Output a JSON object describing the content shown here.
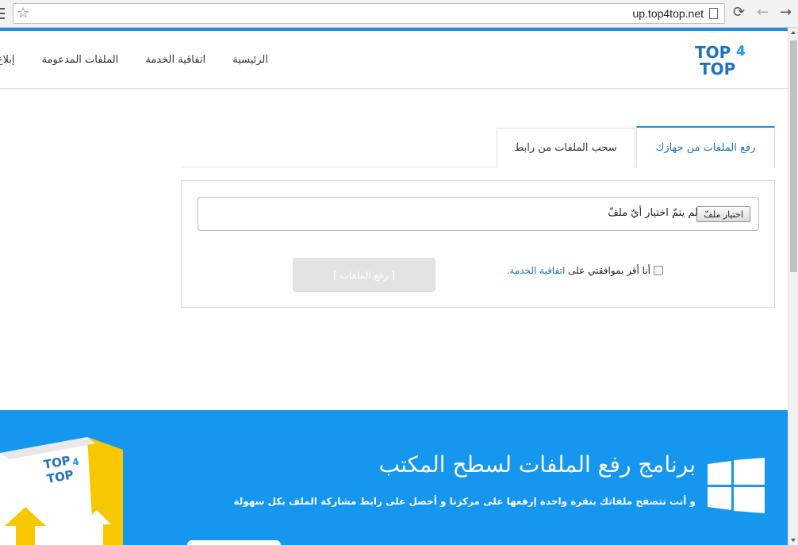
{
  "browser": {
    "url": "up.top4top.net",
    "star_icon": "star-icon",
    "page_icon": "page-icon"
  },
  "header": {
    "logo_top": "TOP",
    "logo_num": "4",
    "logo_bottom": "TOP",
    "nav": {
      "home": "الرئيسية",
      "terms": "اتفاقية الخدمة",
      "supported": "الملفات المدعومة",
      "report": "إبلاغ عن"
    }
  },
  "tabs": {
    "upload_device": "رفع الملفات من جهازك",
    "upload_link": "سحب الملفات من رابط"
  },
  "form": {
    "file_button": "اختيار ملفّ",
    "file_status": "لم يتمّ اختيار أيّ ملفّ",
    "agree_prefix": "أنا أقر بموافقتي على",
    "agree_link": "اتفاقية الخدمة.",
    "submit": "[ رفع الملفات ]"
  },
  "banner": {
    "title": "برنامج رفع الملفات لسطح المكتب",
    "text": "و أنت تتصفح ملفاتك بنقرة واحدة إرفعها على مركزنا و أحصل على رابط مشاركة الملف بكل سهولة"
  },
  "colors": {
    "accent": "#1e90ea",
    "link": "#1e73be",
    "banner": "#1596ef"
  }
}
